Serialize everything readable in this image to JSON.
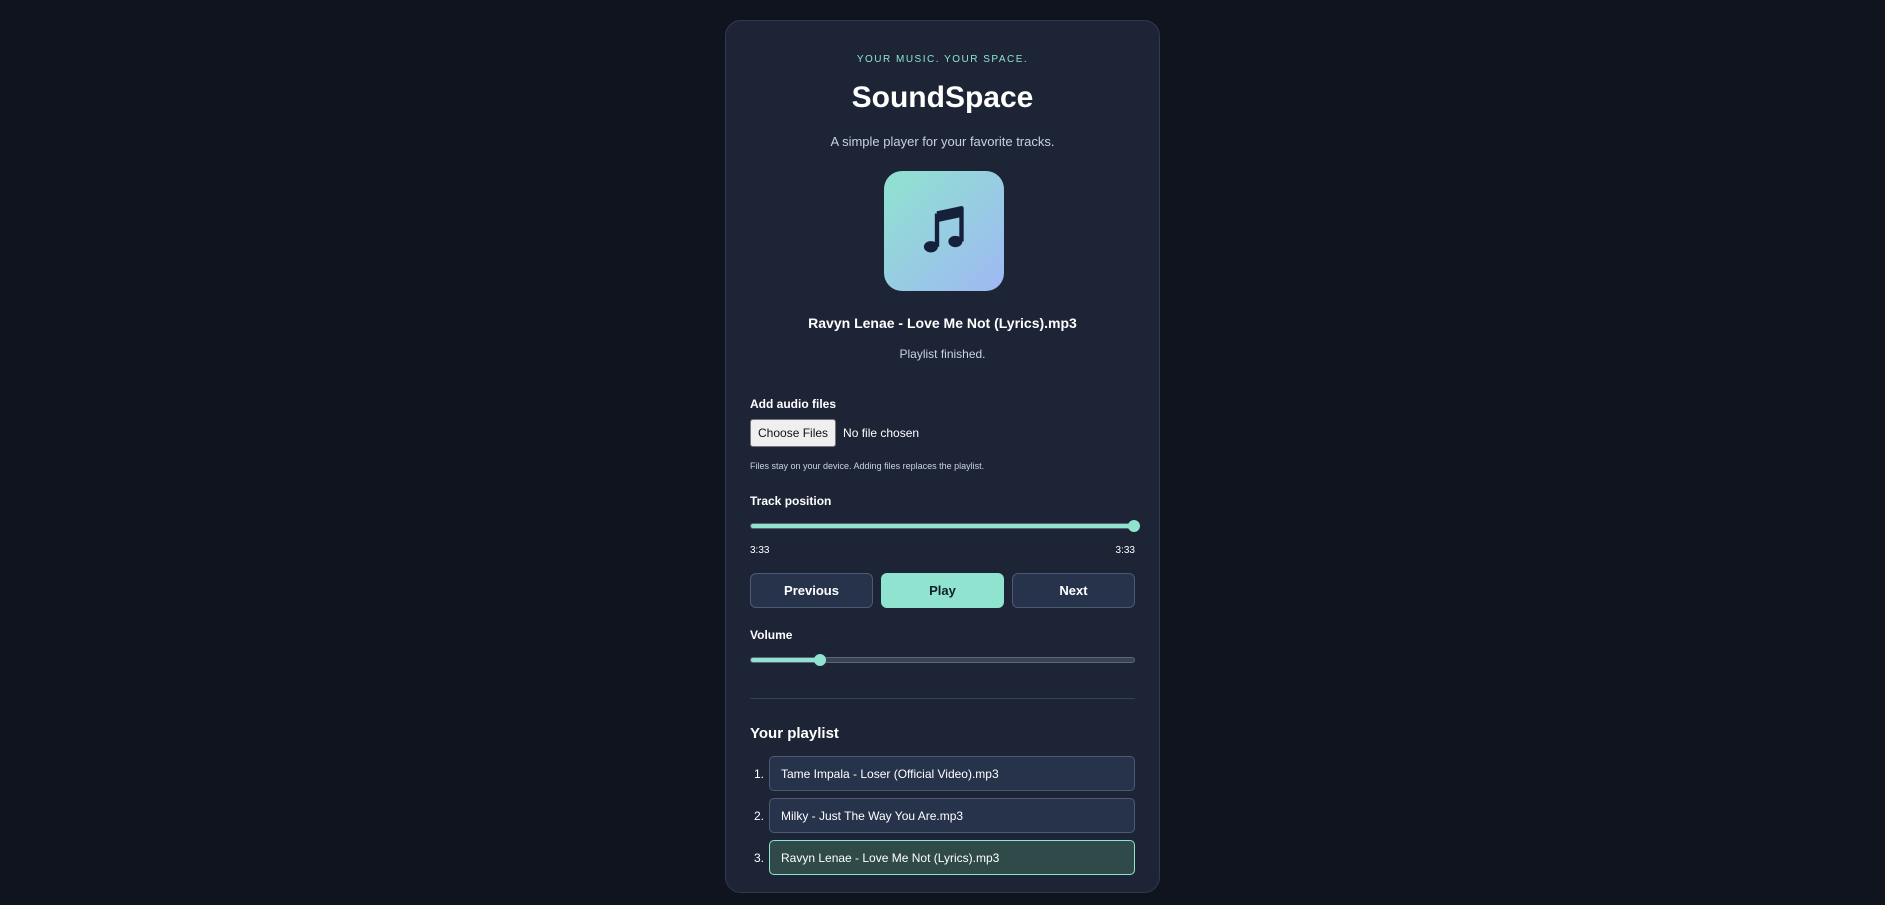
{
  "app": {
    "tagline": "YOUR MUSIC. YOUR SPACE.",
    "title": "SoundSpace",
    "subtitle": "A simple player for your favorite tracks."
  },
  "now_playing": {
    "art_icon": "music-note-icon",
    "track_name": "Ravyn Lenae - Love Me Not (Lyrics).mp3",
    "status": "Playlist finished."
  },
  "file_input": {
    "label": "Add audio files",
    "button_label": "Choose Files",
    "chosen_text": "No file chosen",
    "hint": "Files stay on your device. Adding files replaces the playlist."
  },
  "position": {
    "label": "Track position",
    "current_time": "3:33",
    "total_time": "3:33",
    "progress": 1.0
  },
  "controls": {
    "previous_label": "Previous",
    "play_label": "Play",
    "next_label": "Next"
  },
  "volume": {
    "label": "Volume",
    "level": 0.18
  },
  "playlist": {
    "title": "Your playlist",
    "items": [
      {
        "num": "1.",
        "name": "Tame Impala - Loser (Official Video).mp3",
        "active": false
      },
      {
        "num": "2.",
        "name": "Milky - Just The Way You Are.mp3",
        "active": false
      },
      {
        "num": "3.",
        "name": "Ravyn Lenae - Love Me Not (Lyrics).mp3",
        "active": true
      }
    ]
  },
  "colors": {
    "background": "#0f141f",
    "card": "#1c2435",
    "accent": "#8fe3cf",
    "button": "#27334a",
    "active_item": "#2f4a49"
  }
}
